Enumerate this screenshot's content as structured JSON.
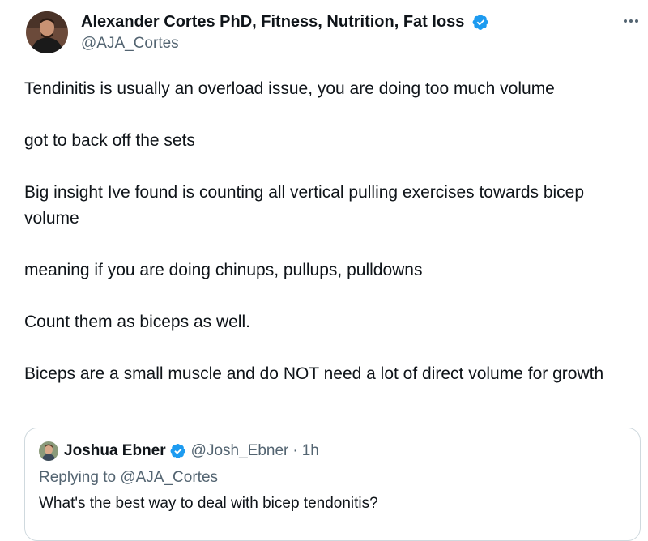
{
  "author": {
    "name": "Alexander Cortes PhD, Fitness, Nutrition, Fat loss",
    "handle": "@AJA_Cortes",
    "verified_color": "#1d9bf0"
  },
  "more_icon": "more-horizontal-icon",
  "tweet": {
    "paragraphs": [
      "Tendinitis is usually an overload issue, you are doing too much volume",
      "got to back off the sets",
      "Big insight Ive found is counting all vertical pulling exercises towards bicep volume",
      "meaning if you are doing chinups, pullups, pulldowns",
      "Count them as biceps as well.",
      "Biceps are a small muscle and do NOT need a lot of direct volume for growth"
    ]
  },
  "quote": {
    "name": "Joshua Ebner",
    "handle": "@Josh_Ebner",
    "separator": "·",
    "time": "1h",
    "replying_prefix": "Replying to",
    "replying_handle": "@AJA_Cortes",
    "text": "What's the best way to deal with bicep tendonitis?"
  },
  "colors": {
    "text_primary": "#0f1419",
    "text_secondary": "#536471",
    "border": "#cfd9de",
    "verified": "#1d9bf0"
  }
}
